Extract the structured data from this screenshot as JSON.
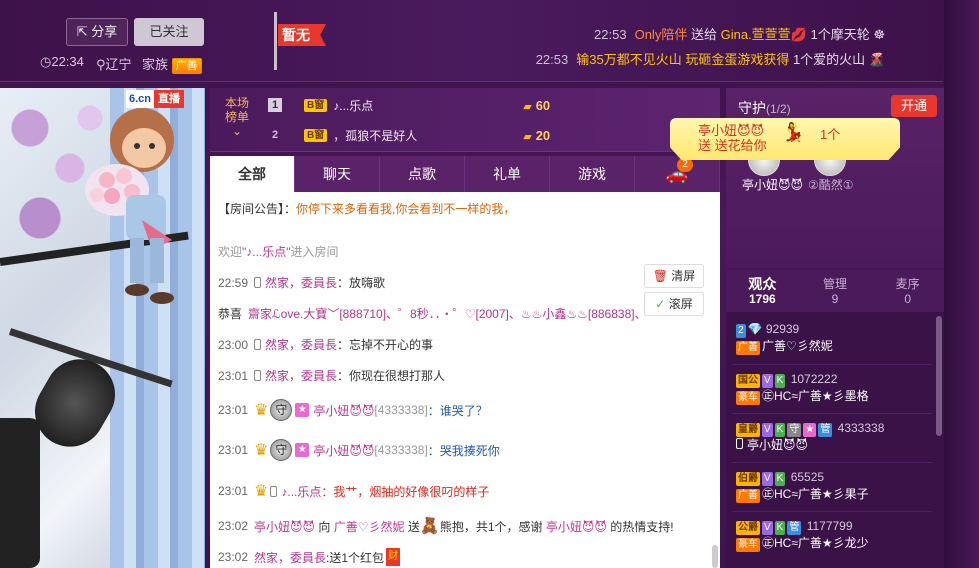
{
  "header": {
    "share_label": "分享",
    "follow_label": "已关注",
    "time": "22:34",
    "location": "辽宁",
    "family_label": "家族",
    "family_badge": "广善",
    "flag_text": "暂无",
    "gifts": [
      {
        "time": "22:53",
        "from": "Only陪伴",
        "verb": "送给",
        "to": "Gina.萱萱萱",
        "item": "1个摩天轮"
      },
      {
        "time": "22:53",
        "text": "输35万都不见火山 玩砸金蛋游戏获得",
        "item": "1个爱的火山"
      }
    ]
  },
  "video": {
    "logo": "6.cn",
    "live_label": "直播"
  },
  "rank": {
    "label": "本场榜单",
    "rows": [
      {
        "pos": "1",
        "badge": "B窗",
        "name": "♪...乐点",
        "score": "60"
      },
      {
        "pos": "2",
        "badge": "B窗",
        "name": "，孤狼不是好人",
        "score": "20"
      }
    ]
  },
  "tabs": [
    "全部",
    "聊天",
    "点歌",
    "礼单",
    "游戏"
  ],
  "tab_badge": "2",
  "chat": {
    "notice_label": "【房间公告】：",
    "notice_text": "你停下来多看看我,你会看到不一样的我，",
    "welcome_pre": "欢迎",
    "welcome_name": "\"♪...乐点\"",
    "welcome_post": "进入房间",
    "clear_label": "清屏",
    "scroll_label": "滚屏",
    "rows": [
      {
        "time": "22:59",
        "name": "然家，委員長",
        "text": "：放嗨歌"
      },
      {
        "pre": "恭喜",
        "text": "齋家ℒove.大寶﹀[888710]、゜8秒．．・゜♡[2007]、♨♨小鑫♨♨[886838]、"
      },
      {
        "time": "23:00",
        "name": "然家，委員長",
        "text": "：忘掉不开心的事"
      },
      {
        "time": "23:01",
        "name": "然家，委員長",
        "text": "：你现在很想打那人"
      },
      {
        "time": "23:01",
        "name": "亭小妞😈😈",
        "id": "[4333338]",
        "text": "：谁哭了？"
      },
      {
        "time": "23:01",
        "name": "亭小妞😈😈",
        "id": "[4333338]",
        "text": "：哭我揍死你"
      },
      {
        "time": "23:01",
        "name": "♪...乐点",
        "text": "：我艹，烟抽的好像很叼的样子"
      },
      {
        "time": "23:02",
        "name": "亭小妞😈😈",
        "to_pre": "向",
        "to": "广善♡彡然妮",
        "verb": "送",
        "gift": "熊抱，共1个，感谢",
        "thanks": "亭小妞😈😈",
        "post": "的热情支持!"
      },
      {
        "time": "23:02",
        "name": "然家，委員長",
        "text": ":送1个红包",
        "bag": "财"
      }
    ]
  },
  "guard": {
    "title": "守护",
    "count": "(1/2)",
    "open_label": "开通",
    "banner_line1": "亭小妞😈😈",
    "banner_line2": "送 送花给你",
    "banner_count": "1个",
    "user1": "亭小妞😈😈",
    "user2": "②酷然①"
  },
  "audience": {
    "tabs": [
      {
        "label": "观众",
        "count": "1796"
      },
      {
        "label": "管理",
        "count": "9"
      },
      {
        "label": "麦序",
        "count": "0"
      }
    ],
    "list": [
      {
        "badges": [
          "2",
          "💎"
        ],
        "num": "92939",
        "tag": "广善",
        "name": "广善♡彡然妮"
      },
      {
        "badges": [
          "国公",
          "V",
          "K"
        ],
        "num": "1072222",
        "tag": "豪车",
        "name": "㊣HC≈广善★彡墨格"
      },
      {
        "badges": [
          "皇爵",
          "V",
          "K",
          "守",
          "★",
          "管"
        ],
        "num": "4333338",
        "name": "亭小妞😈😈"
      },
      {
        "badges": [
          "伯爵",
          "V",
          "K"
        ],
        "num": "65525",
        "tag": "广善",
        "name": "㊣HC≈广善★彡果子"
      },
      {
        "badges": [
          "公爵",
          "V",
          "K",
          "管"
        ],
        "num": "1177799",
        "tag": "豪车",
        "name": "㊣HC≈广善★彡龙少"
      }
    ]
  }
}
